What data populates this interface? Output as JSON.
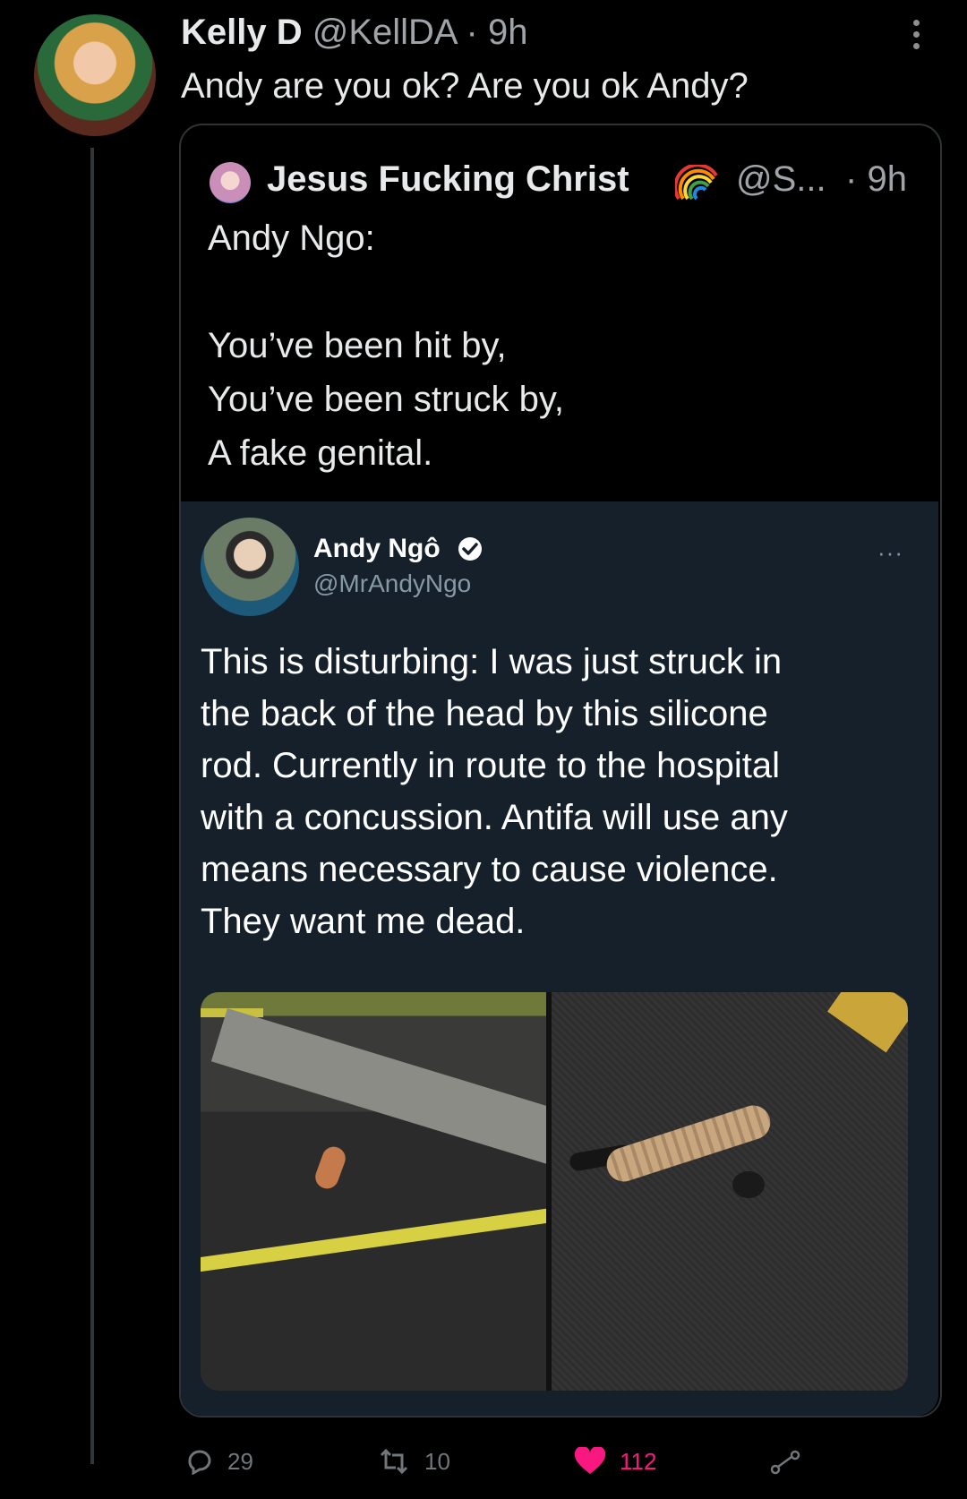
{
  "tweet": {
    "author_name": "Kelly D",
    "author_handle": "@KellDA",
    "separator": "·",
    "time": "9h",
    "text": "Andy are you ok? Are you ok Andy?"
  },
  "quote": {
    "author_name": "Jesus Fucking Christ",
    "author_handle": "@S...",
    "separator": "·",
    "time": "9h",
    "lines": [
      "Andy Ngo:",
      "",
      "You’ve been hit by,",
      "You’ve been struck by,",
      "A fake genital."
    ],
    "rainbow_icon": "rainbow-icon"
  },
  "screenshot": {
    "author_name": "Andy Ngô",
    "author_handle": "@MrAndyNgo",
    "more": "···",
    "lines": [
      "This is disturbing: I was just struck in",
      "the back of the head by this silicone",
      "rod. Currently in route to the hospital",
      "with a concussion. Antifa will use any",
      "means necessary to cause violence.",
      "They want me dead."
    ]
  },
  "actions": {
    "replies": "29",
    "retweets": "10",
    "likes": "112",
    "colors": {
      "muted": "#71767b",
      "like": "#f91880"
    }
  }
}
